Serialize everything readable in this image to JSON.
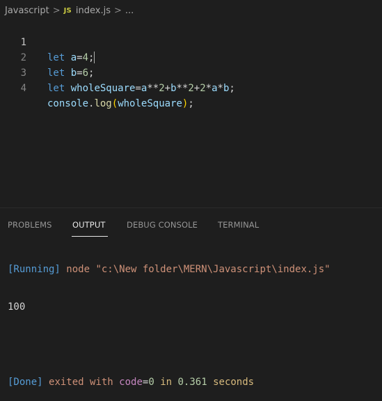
{
  "breadcrumb": {
    "folder": "Javascript",
    "file_badge": "JS",
    "file": "index.js",
    "ellipsis": "...",
    "separator": ">"
  },
  "editor": {
    "lines": [
      {
        "number": "1",
        "tokens": [
          "let",
          "a",
          "=",
          "4",
          ";"
        ]
      },
      {
        "number": "2",
        "tokens": [
          "let",
          "b",
          "=",
          "6",
          ";"
        ]
      },
      {
        "number": "3",
        "tokens": [
          "let",
          "wholeSquare",
          "=",
          "a",
          "**",
          "2",
          "+",
          "b",
          "**",
          "2",
          "+",
          "2",
          "*",
          "a",
          "*",
          "b",
          ";"
        ]
      },
      {
        "number": "4",
        "tokens": [
          "console",
          ".",
          "log",
          "(",
          "wholeSquare",
          ")",
          ";"
        ]
      }
    ]
  },
  "panel": {
    "tabs": [
      "PROBLEMS",
      "OUTPUT",
      "DEBUG CONSOLE",
      "TERMINAL"
    ],
    "active_tab": "OUTPUT"
  },
  "output": {
    "running_tag": "[Running]",
    "command": "node \"c:\\New folder\\MERN\\Javascript\\index.js\"",
    "result": "100",
    "done_tag": "[Done]",
    "exited_text": "exited with",
    "code_label": "code",
    "code_eq": "=",
    "code_value": "0",
    "in_text": "in",
    "time_value": "0.361",
    "seconds_text": "seconds"
  },
  "colors": {
    "background": "#1e1e1e",
    "keyword": "#569cd6",
    "variable": "#9cdcfe",
    "number": "#b5cea8",
    "function": "#dcdcaa",
    "string": "#ce9178",
    "bracket": "#ffd700"
  }
}
